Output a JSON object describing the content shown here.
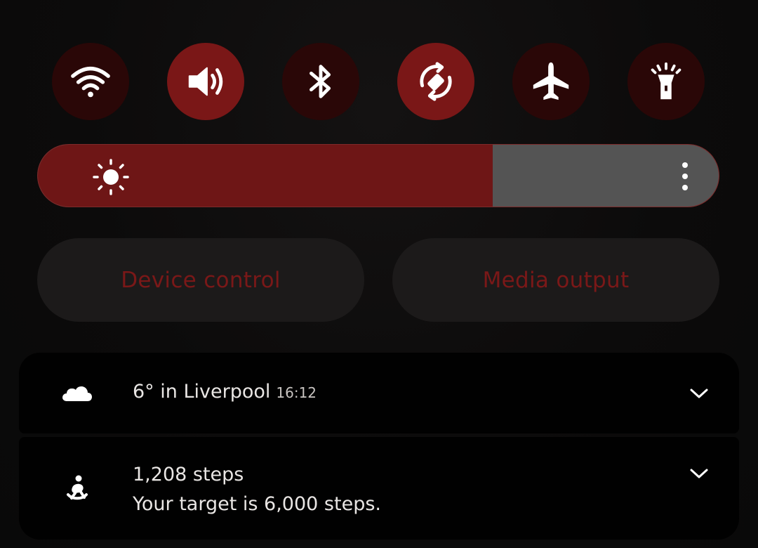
{
  "toggles": [
    {
      "name": "wifi",
      "icon": "wifi-icon",
      "state": "off"
    },
    {
      "name": "sound",
      "icon": "speaker-icon",
      "state": "on"
    },
    {
      "name": "bluetooth",
      "icon": "bluetooth-icon",
      "state": "off"
    },
    {
      "name": "auto-rotate",
      "icon": "rotate-icon",
      "state": "on"
    },
    {
      "name": "airplane-mode",
      "icon": "airplane-icon",
      "state": "off"
    },
    {
      "name": "flashlight",
      "icon": "flashlight-icon",
      "state": "off"
    }
  ],
  "brightness": {
    "level": 0.668,
    "icon": "sun-icon",
    "menu_icon": "more-vertical-icon"
  },
  "buttons": {
    "device_control": "Device control",
    "media_output": "Media output"
  },
  "weather": {
    "icon": "cloud-icon",
    "text": "6° in Liverpool",
    "time": "16:12",
    "chevron_icon": "chevron-down-icon"
  },
  "steps": {
    "icon": "fitness-icon",
    "title": "1,208 steps",
    "subtitle": "Your target is 6,000 steps.",
    "chevron_icon": "chevron-down-icon"
  },
  "colors": {
    "toggle_off": "#2a0707",
    "toggle_on": "#7a1717",
    "slider_fill": "#6e1616",
    "slider_track": "#545454",
    "button_text": "#7a1818"
  }
}
